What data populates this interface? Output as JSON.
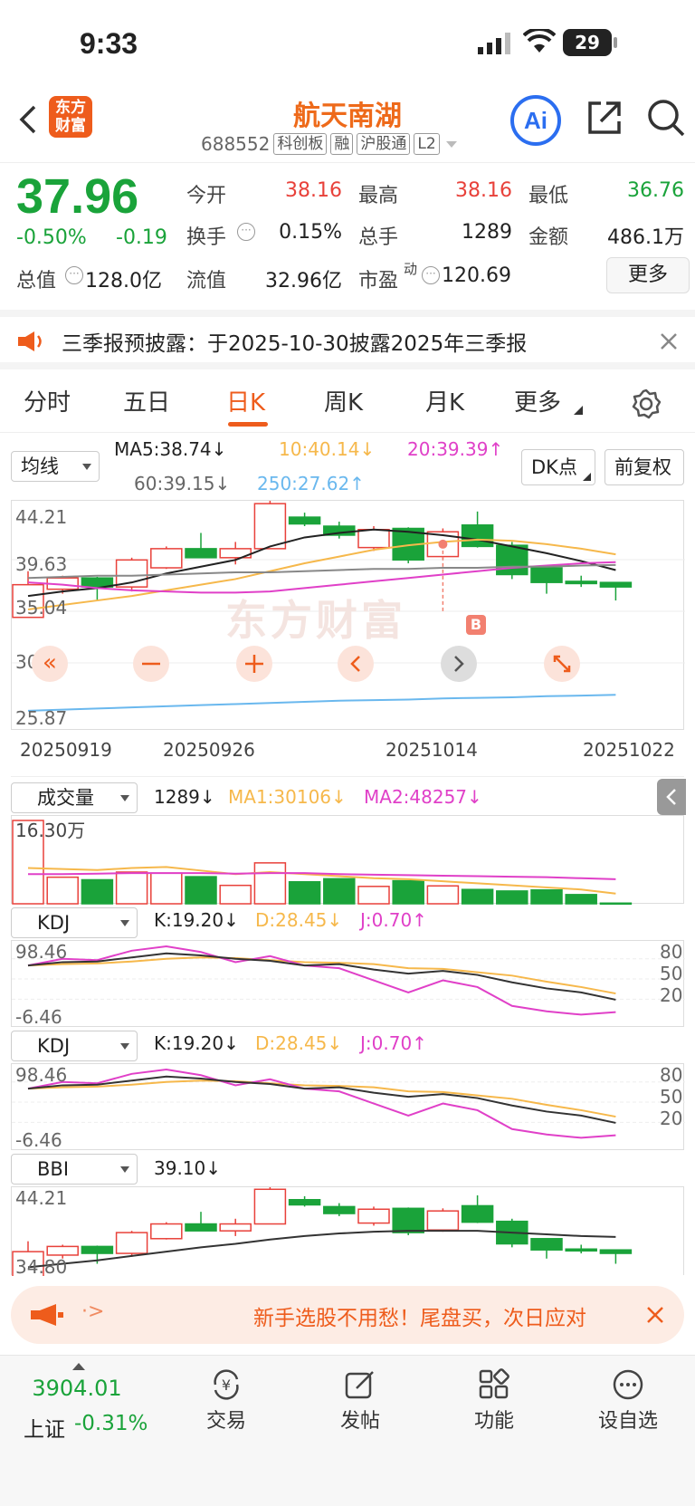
{
  "status_bar": {
    "time": "9:33",
    "battery": "29"
  },
  "header": {
    "back_icon": "chevron-left-icon",
    "logo_line1": "东方",
    "logo_line2": "财富",
    "title": "航天南湖",
    "code": "688552",
    "tags": [
      "科创板",
      "融",
      "沪股通",
      "L2"
    ],
    "ai_label": "Ai"
  },
  "quote": {
    "price": "37.96",
    "change_pct": "-0.50%",
    "change": "-0.19",
    "open_label": "今开",
    "open": "38.16",
    "high_label": "最高",
    "high": "38.16",
    "low_label": "最低",
    "low": "36.76",
    "turnover_label": "换手",
    "turnover": "0.15%",
    "volume_label": "总手",
    "volume": "1289",
    "amount_label": "金额",
    "amount": "486.1万",
    "mktcap_label": "总值",
    "mktcap": "128.0亿",
    "float_label": "流值",
    "float": "32.96亿",
    "pe_label": "市盈",
    "pe_sup": "动",
    "pe": "120.69",
    "more_label": "更多"
  },
  "notice": {
    "text": "三季报预披露：于2025-10-30披露2025年三季报"
  },
  "tabs": [
    "分时",
    "五日",
    "日K",
    "周K",
    "月K",
    "更多"
  ],
  "active_tab": "日K",
  "kline": {
    "ma_select": "均线",
    "ma5": "MA5:38.74↓",
    "ma10": "10:40.14↓",
    "ma20": "20:39.39↑",
    "ma60": "60:39.15↓",
    "ma250": "250:27.62↑",
    "dk_label": "DK点",
    "adjust_label": "前复权",
    "y_labels": [
      "44.21",
      "39.63",
      "35.04",
      "30.46",
      "25.87"
    ],
    "x_labels": [
      "20250919",
      "20250926",
      "20251014",
      "20251022"
    ],
    "marker": "B",
    "watermark": "东方财富",
    "colors": {
      "up": "#e8413a",
      "down": "#1aa33a",
      "ma5": "#222222",
      "ma10": "#f6b84b",
      "ma20": "#e040c8",
      "ma60": "#888888",
      "ma250": "#6ab8ee"
    }
  },
  "volume_panel": {
    "select": "成交量",
    "value": "1289↓",
    "ma1": "MA1:30106↓",
    "ma2": "MA2:48257↓",
    "top_label": "16.30万"
  },
  "kdj1": {
    "select": "KDJ",
    "k": "K:19.20↓",
    "d": "D:28.45↓",
    "j": "J:0.70↑",
    "top": "98.46",
    "bottom": "-6.46",
    "levels": [
      "80",
      "50",
      "20"
    ]
  },
  "kdj2": {
    "select": "KDJ",
    "k": "K:19.20↓",
    "d": "D:28.45↓",
    "j": "J:0.70↑",
    "top": "98.46",
    "bottom": "-6.46",
    "levels": [
      "80",
      "50",
      "20"
    ]
  },
  "bbi": {
    "select": "BBI",
    "value": "39.10↓",
    "top": "44.21",
    "bottom": "34.80"
  },
  "promo": {
    "arrow": "·>",
    "text": "新手选股不用愁！尾盘买，次日应对"
  },
  "bottom_nav": {
    "index_value": "3904.01",
    "index_name": "上证",
    "index_change": "-0.31%",
    "items": [
      "交易",
      "发帖",
      "功能",
      "设自选"
    ]
  }
}
